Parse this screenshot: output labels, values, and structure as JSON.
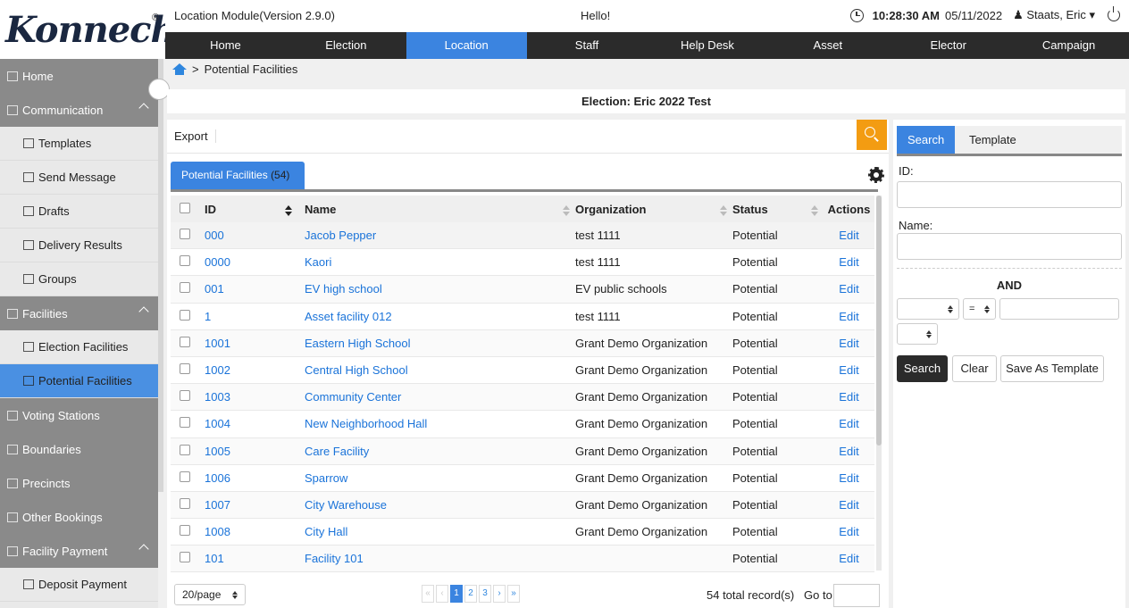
{
  "brand": {
    "logo": "Konnech",
    "reg": "®"
  },
  "topbar": {
    "module": "Location Module(Version 2.9.0)",
    "greeting": "Hello!",
    "time": "10:28:30 AM",
    "date": "05/11/2022",
    "user": "Staats, Eric",
    "user_caret": "▾"
  },
  "nav": [
    "Home",
    "Election",
    "Location",
    "Staff",
    "Help Desk",
    "Asset",
    "Elector",
    "Campaign"
  ],
  "nav_active": "Location",
  "sidebar": {
    "home": "Home",
    "communication": "Communication",
    "templates": "Templates",
    "send_message": "Send Message",
    "drafts": "Drafts",
    "delivery_results": "Delivery Results",
    "groups": "Groups",
    "facilities": "Facilities",
    "election_facilities": "Election Facilities",
    "potential_facilities": "Potential Facilities",
    "voting_stations": "Voting Stations",
    "boundaries": "Boundaries",
    "precincts": "Precincts",
    "other_bookings": "Other Bookings",
    "facility_payment": "Facility Payment",
    "deposit_payment": "Deposit Payment"
  },
  "breadcrumb": {
    "sep": ">",
    "current": "Potential Facilities"
  },
  "election_title": "Election: Eric 2022 Test",
  "toolbar": {
    "export": "Export"
  },
  "tab": {
    "label": "Potential Facilities",
    "count": "(54)"
  },
  "table": {
    "headers": {
      "id": "ID",
      "name": "Name",
      "organization": "Organization",
      "status": "Status",
      "actions": "Actions"
    },
    "rows": [
      {
        "id": "000",
        "name": "Jacob Pepper",
        "org": "test 1111",
        "status": "Potential",
        "action": "Edit"
      },
      {
        "id": "0000",
        "name": "Kaori",
        "org": "test 1111",
        "status": "Potential",
        "action": "Edit"
      },
      {
        "id": "001",
        "name": "EV high school",
        "org": "EV public schools",
        "status": "Potential",
        "action": "Edit"
      },
      {
        "id": "1",
        "name": "Asset facility 012",
        "org": "test 1111",
        "status": "Potential",
        "action": "Edit"
      },
      {
        "id": "1001",
        "name": "Eastern High School",
        "org": "Grant Demo Organization",
        "status": "Potential",
        "action": "Edit"
      },
      {
        "id": "1002",
        "name": "Central High School",
        "org": "Grant Demo Organization",
        "status": "Potential",
        "action": "Edit"
      },
      {
        "id": "1003",
        "name": "Community Center",
        "org": "Grant Demo Organization",
        "status": "Potential",
        "action": "Edit"
      },
      {
        "id": "1004",
        "name": "New Neighborhood Hall",
        "org": "Grant Demo Organization",
        "status": "Potential",
        "action": "Edit"
      },
      {
        "id": "1005",
        "name": "Care Facility",
        "org": "Grant Demo Organization",
        "status": "Potential",
        "action": "Edit"
      },
      {
        "id": "1006",
        "name": "Sparrow",
        "org": "Grant Demo Organization",
        "status": "Potential",
        "action": "Edit"
      },
      {
        "id": "1007",
        "name": "City Warehouse",
        "org": "Grant Demo Organization",
        "status": "Potential",
        "action": "Edit"
      },
      {
        "id": "1008",
        "name": "City Hall",
        "org": "Grant Demo Organization",
        "status": "Potential",
        "action": "Edit"
      },
      {
        "id": "101",
        "name": "Facility 101",
        "org": "",
        "status": "Potential",
        "action": "Edit"
      }
    ]
  },
  "pager": {
    "page_size": "20/page",
    "first": "«",
    "prev": "‹",
    "pages": [
      "1",
      "2",
      "3"
    ],
    "next": "›",
    "last": "»",
    "current_page": "1",
    "total": "54 total record(s)",
    "goto": "Go to"
  },
  "search_panel": {
    "tab_search": "Search",
    "tab_template": "Template",
    "id_label": "ID:",
    "name_label": "Name:",
    "and_label": "AND",
    "operator": "=",
    "search_button": "Search",
    "clear_button": "Clear",
    "save_template_button": "Save As Template"
  },
  "colors": {
    "accent": "#3b84e0",
    "nav_bg": "#2b2b2b",
    "orange": "#f39c12",
    "link": "#1a73d9"
  }
}
